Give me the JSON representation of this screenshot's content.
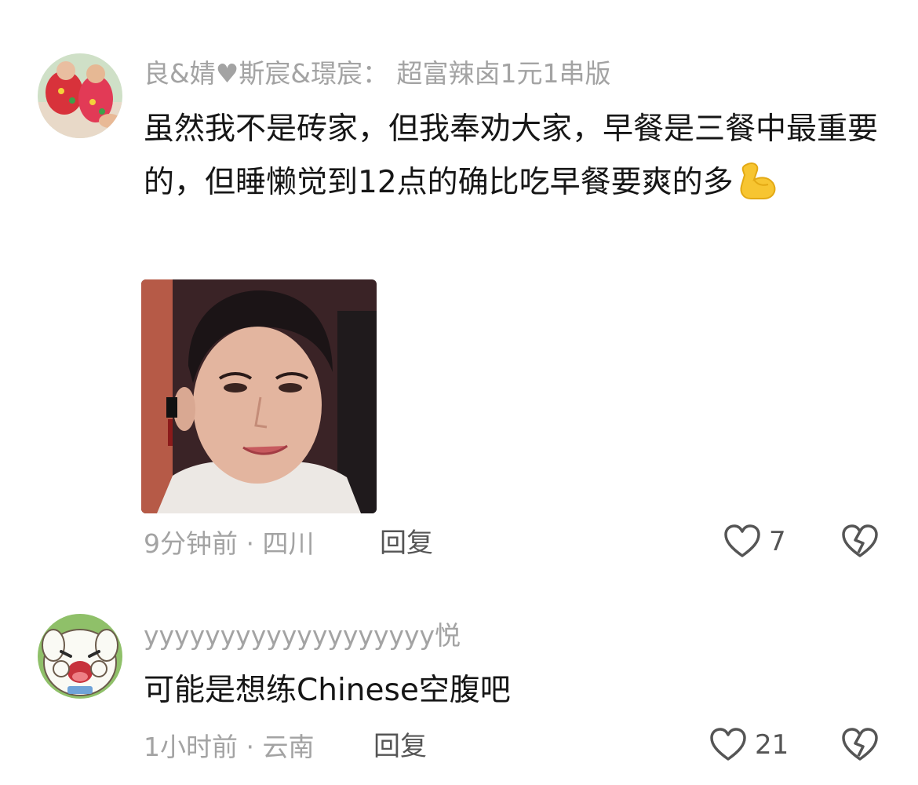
{
  "comments": [
    {
      "username": "良&婧♥斯宸&璟宸： 超富辣卤1元1串版",
      "text": "虽然我不是砖家，但我奉劝大家，早餐是三餐中最重要的，但睡懒觉到12点的确比吃早餐要爽的多",
      "emoji": "flexed-biceps-icon",
      "time": "9分钟前",
      "location": "四川",
      "reply_label": "回复",
      "likes": "7"
    },
    {
      "username": "yyyyyyyyyyyyyyyyyyy悦",
      "text": "可能是想练Chinese空腹吧",
      "time": "1小时前",
      "location": "云南",
      "reply_label": "回复",
      "likes": "21"
    }
  ],
  "colors": {
    "meta": "#a3a3a3",
    "text": "#161616",
    "action": "#555555",
    "emoji": "#f7c531"
  }
}
